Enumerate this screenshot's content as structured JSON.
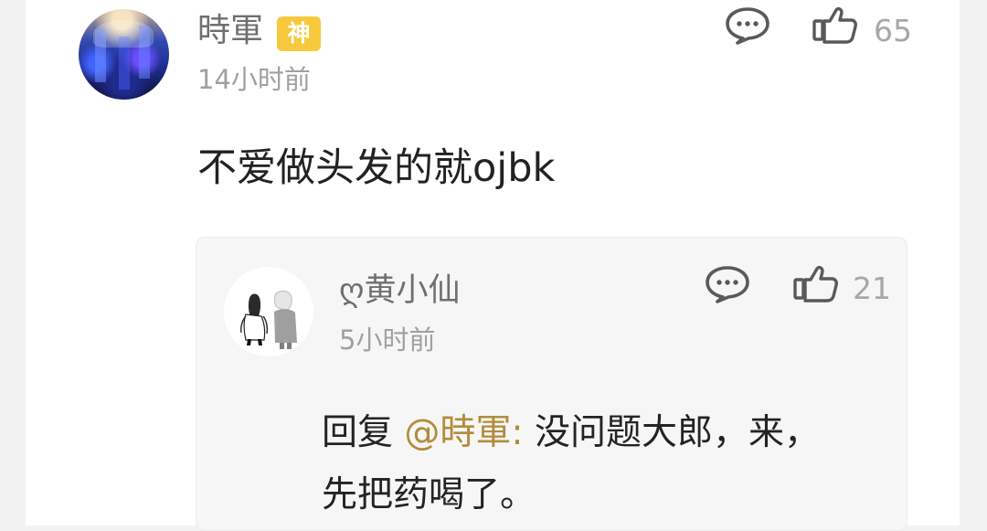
{
  "comment": {
    "username": "時軍",
    "badge": "神",
    "timestamp": "14小时前",
    "likes": "65",
    "content": "不爱做头发的就ojbk",
    "comment_icon_name": "comment-icon",
    "like_icon_name": "like-icon"
  },
  "reply": {
    "username": "ღ黄小仙",
    "timestamp": "5小时前",
    "likes": "21",
    "prefix": "回复 ",
    "mention": "@時軍:",
    "content": " 没问题大郎，来，\n先把药喝了。",
    "comment_icon_name": "comment-icon",
    "like_icon_name": "like-icon"
  },
  "colors": {
    "badge": "#f6c93d",
    "mention": "#b28c3b",
    "secondary_text": "#a0a0a0",
    "primary_text": "#222222",
    "icon": "#595959"
  }
}
